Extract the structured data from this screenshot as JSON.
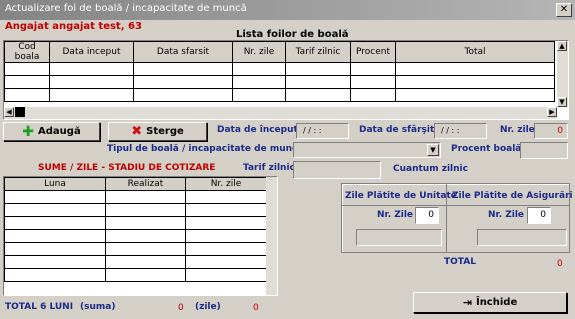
{
  "window": {
    "title": "Actualizare foi de boală / incapacitate de muncă",
    "close_glyph": "✕"
  },
  "header": {
    "employee": "Angajat angajat test, 63",
    "list_title": "Lista foilor de boală"
  },
  "sick_table": {
    "columns": [
      "Cod boala",
      "Data inceput",
      "Data sfarsit",
      "Nr. zile",
      "Tarif zilnic",
      "Procent",
      "Total"
    ]
  },
  "buttons": {
    "add": "Adaugă",
    "delete": "Sterge",
    "close": "Închide"
  },
  "form": {
    "start_label": "Data de început",
    "start_value": "/ /   : :",
    "end_label": "Data de sfârşit",
    "end_value": "/ /   : :",
    "days_label": "Nr. zile",
    "days_value": "0",
    "type_label": "Tipul de boală / incapacitate de muncă",
    "percent_label": "Procent boală",
    "daily_rate_label": "Tarif zilnic",
    "quantum_label": "Cuantum zilnic"
  },
  "stage": {
    "title": "SUME / ZILE - STADIU DE COTIZARE",
    "columns": [
      "Luna",
      "Realizat",
      "Nr. zile"
    ],
    "total_label": "TOTAL 6 LUNI",
    "sum_label": "(suma)",
    "sum_value": "0",
    "days_label": "(zile)",
    "days_value": "0"
  },
  "paid_unit": {
    "title": "Zile Plătite de Unitate",
    "days_label": "Nr. Zile",
    "days_value": "0"
  },
  "paid_insurance": {
    "title": "Zile Plătite de Asigurări",
    "days_label": "Nr. Zile",
    "days_value": "0"
  },
  "totals": {
    "label": "TOTAL",
    "value": "0"
  },
  "colors": {
    "accent_red": "#c00000",
    "label_navy": "#1a2a8a",
    "add_icon": "#1e9e1e",
    "delete_icon": "#d01010"
  }
}
